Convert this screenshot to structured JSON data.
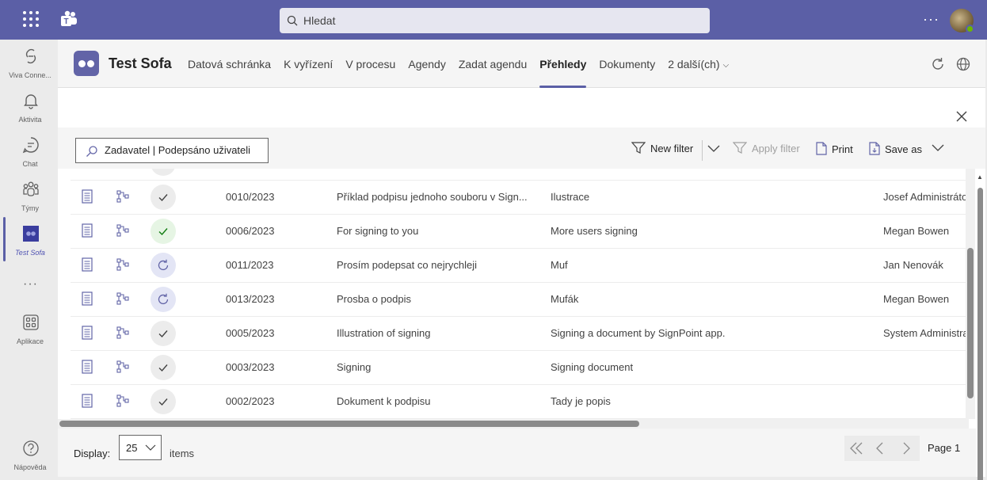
{
  "topbar": {
    "search_placeholder": "Hledat"
  },
  "rail": {
    "items": [
      {
        "label": "Viva Conne...",
        "icon": "viva-connections-icon"
      },
      {
        "label": "Aktivita",
        "icon": "bell-icon"
      },
      {
        "label": "Chat",
        "icon": "chat-icon"
      },
      {
        "label": "Týmy",
        "icon": "teams-icon"
      },
      {
        "label": "Test Sofa",
        "icon": "test-sofa-app-icon"
      },
      {
        "label": "Aplikace",
        "icon": "apps-icon"
      },
      {
        "label": "Nápověda",
        "icon": "help-icon"
      }
    ]
  },
  "app": {
    "title": "Test Sofa",
    "tabs": [
      {
        "label": "Datová schránka"
      },
      {
        "label": "K vyřízení"
      },
      {
        "label": "V procesu"
      },
      {
        "label": "Agendy"
      },
      {
        "label": "Zadat agendu"
      },
      {
        "label": "Přehledy"
      },
      {
        "label": "Dokumenty"
      },
      {
        "label": "2 další(ch)"
      }
    ],
    "active_tab": "Přehledy"
  },
  "toolbar": {
    "filter_text": "Zadavatel | Podepsáno uživateli",
    "new_filter": "New filter",
    "apply_filter": "Apply filter",
    "print": "Print",
    "save_as": "Save as"
  },
  "grid": {
    "rows": [
      {
        "number": "0010/2023",
        "name": "Příklad podpisu jednoho souboru v Sign...",
        "description": "Ilustrace",
        "user": "Josef Administrátor",
        "status": "done"
      },
      {
        "number": "0006/2023",
        "name": "For signing to you",
        "description": "More users signing",
        "user": "Megan Bowen",
        "status": "done-green"
      },
      {
        "number": "0011/2023",
        "name": "Prosím podepsat co nejrychleji",
        "description": "Muf",
        "user": "Jan Nenovák",
        "status": "in-progress"
      },
      {
        "number": "0013/2023",
        "name": "Prosba o podpis",
        "description": "Mufák",
        "user": "Megan Bowen",
        "status": "in-progress"
      },
      {
        "number": "0005/2023",
        "name": "Illustration of signing",
        "description": "Signing a document by SignPoint app.",
        "user": "System Administrator",
        "status": "done"
      },
      {
        "number": "0003/2023",
        "name": "Signing",
        "description": "Signing document",
        "user": "",
        "status": "done"
      },
      {
        "number": "0002/2023",
        "name": "Dokument k podpisu",
        "description": "Tady je popis",
        "user": "",
        "status": "done"
      }
    ]
  },
  "footer": {
    "display_label": "Display:",
    "page_size": "25",
    "items_label": "items",
    "page_label": "Page 1"
  },
  "colors": {
    "brand": "#5b5fa6",
    "accent": "#6264a7",
    "done_green": "#107c10"
  }
}
